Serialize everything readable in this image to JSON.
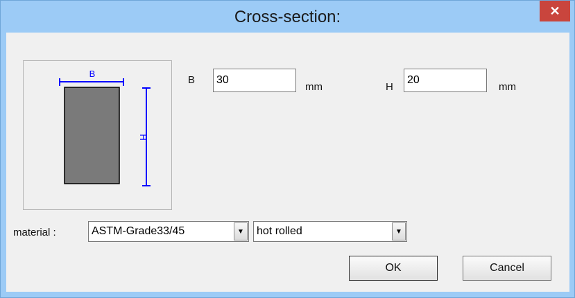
{
  "window": {
    "title": "Cross-section:",
    "close_label": "✕"
  },
  "preview": {
    "b_label": "B",
    "h_label": "H"
  },
  "fields": {
    "b_label": "B",
    "b_value": "30",
    "b_unit": "mm",
    "h_label": "H",
    "h_value": "20",
    "h_unit": "mm"
  },
  "material": {
    "label": "material :",
    "grade": "ASTM-Grade33/45",
    "process": "hot rolled"
  },
  "buttons": {
    "ok": "OK",
    "cancel": "Cancel"
  },
  "colors": {
    "titlebar": "#9ccbf6",
    "close": "#c9453d",
    "section_fill": "#7a7a7a",
    "dimension_line": "#0000ff"
  }
}
